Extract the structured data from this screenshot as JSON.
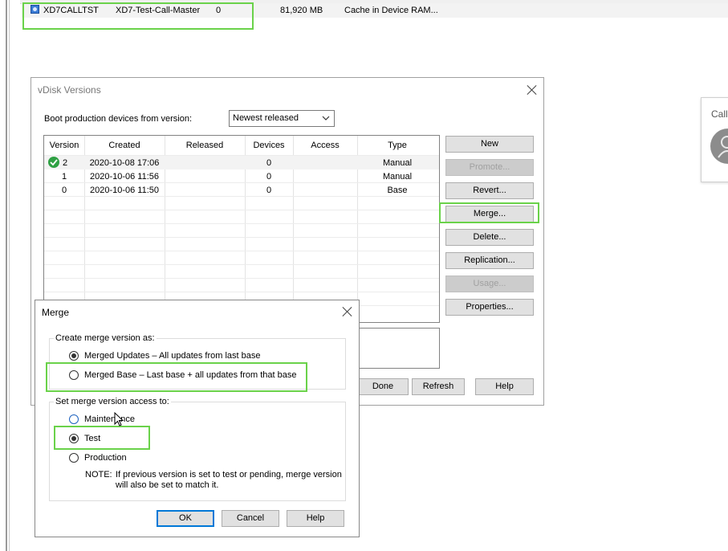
{
  "disk_list": {
    "row": {
      "name": "XD7CALLTST",
      "description": "XD7-Test-Call-Master",
      "count": "0",
      "size": "81,920 MB",
      "cache": "Cache in Device RAM..."
    }
  },
  "side_panel": {
    "label": "Call"
  },
  "vdisk_dialog": {
    "title": "vDisk Versions",
    "boot_label": "Boot production devices from version:",
    "boot_value": "Newest released",
    "columns": [
      "Version",
      "Created",
      "Released",
      "Devices",
      "Access",
      "Type"
    ],
    "rows": [
      {
        "version": "2",
        "created": "2020-10-08 17:06",
        "released": "",
        "devices": "0",
        "access": "",
        "type": "Manual"
      },
      {
        "version": "1",
        "created": "2020-10-06 11:56",
        "released": "",
        "devices": "0",
        "access": "",
        "type": "Manual"
      },
      {
        "version": "0",
        "created": "2020-10-06 11:50",
        "released": "",
        "devices": "0",
        "access": "",
        "type": "Base"
      }
    ],
    "buttons": {
      "new": "New",
      "promote": "Promote...",
      "revert": "Revert...",
      "merge": "Merge...",
      "delete": "Delete...",
      "replication": "Replication...",
      "usage": "Usage...",
      "properties": "Properties...",
      "done": "Done",
      "refresh": "Refresh",
      "help": "Help"
    }
  },
  "merge_dialog": {
    "title": "Merge",
    "create_group_label": "Create merge version as:",
    "option_updates": "Merged Updates – All updates from last base",
    "option_base": "Merged Base – Last base + all updates from that base",
    "selected_create": "updates",
    "access_group_label": "Set merge version access to:",
    "access_maintenance": "Maintenance",
    "access_test": "Test",
    "access_production": "Production",
    "selected_access": "test",
    "note_prefix": "NOTE:",
    "note_line1": "If previous version is set to test or pending, merge version",
    "note_line2": "will also be set to match it.",
    "ok": "OK",
    "cancel": "Cancel",
    "help": "Help"
  },
  "colors": {
    "highlight": "#6ad24a",
    "accent": "#0078d7",
    "check": "#2ea043"
  }
}
